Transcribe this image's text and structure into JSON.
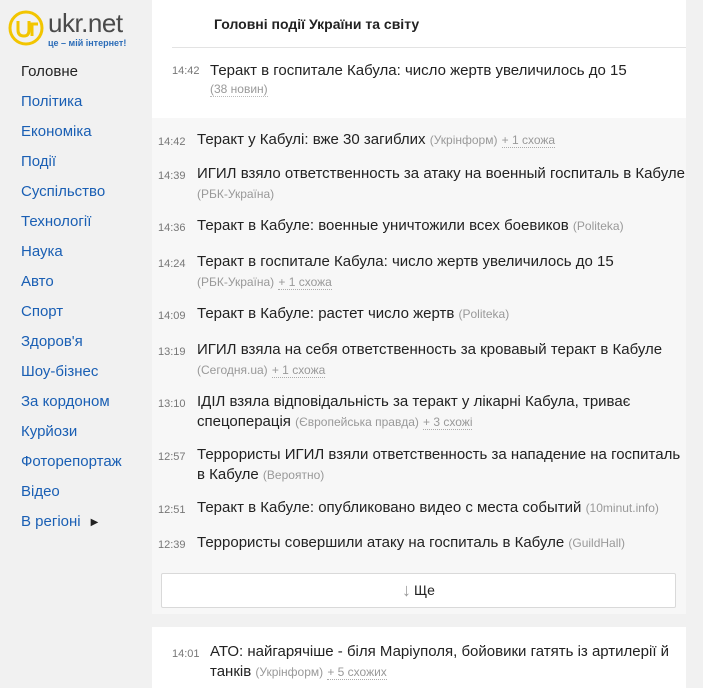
{
  "logo": {
    "name": "ukr.net",
    "tagline": "це – мій інтернет!"
  },
  "sidebar": {
    "items": [
      {
        "label": "Головне",
        "active": true
      },
      {
        "label": "Політика"
      },
      {
        "label": "Економіка"
      },
      {
        "label": "Події"
      },
      {
        "label": "Суспільство"
      },
      {
        "label": "Технології"
      },
      {
        "label": "Наука"
      },
      {
        "label": "Авто"
      },
      {
        "label": "Спорт"
      },
      {
        "label": "Здоров'я"
      },
      {
        "label": "Шоу-бізнес"
      },
      {
        "label": "За кордоном"
      },
      {
        "label": "Курйози"
      },
      {
        "label": "Фоторепортаж"
      },
      {
        "label": "Відео"
      },
      {
        "label": "В регіоні"
      }
    ]
  },
  "header": {
    "title": "Головні події України та світу"
  },
  "lead": {
    "time": "14:42",
    "title": "Теракт в госпитале Кабула: число жертв увеличилось до 15",
    "count": "(38 новин)"
  },
  "news": [
    {
      "time": "14:42",
      "title": "Теракт у Кабулі: вже 30 загиблих",
      "source": "(Укрінформ)",
      "similar": "+ 1 схожа"
    },
    {
      "time": "14:39",
      "title": "ИГИЛ взяло ответственность за атаку на военный госпиталь в Кабуле",
      "source": "(РБК-Україна)",
      "similar": ""
    },
    {
      "time": "14:36",
      "title": "Теракт в Кабуле: военные уничтожили всех боевиков",
      "source": "(Politeka)",
      "similar": ""
    },
    {
      "time": "14:24",
      "title": "Теракт в госпитале Кабула: число жертв увеличилось до 15",
      "source": "(РБК-Україна)",
      "similar": "+ 1 схожа"
    },
    {
      "time": "14:09",
      "title": "Теракт в Кабуле: растет число жертв",
      "source": "(Politeka)",
      "similar": ""
    },
    {
      "time": "13:19",
      "title": "ИГИЛ взяла на себя ответственность за кровавый теракт в Кабуле",
      "source": "(Сегодня.ua)",
      "similar": "+ 1 схожа"
    },
    {
      "time": "13:10",
      "title": "ІДІЛ взяла відповідальність за теракт у лікарні Кабула, триває спецоперація",
      "source": "(Європейська правда)",
      "similar": "+ 3 схожі"
    },
    {
      "time": "12:57",
      "title": "Террористы ИГИЛ взяли ответственность за нападение на госпиталь в Кабуле",
      "source": "(Вероятно)",
      "similar": ""
    },
    {
      "time": "12:51",
      "title": "Теракт в Кабуле: опубликовано видео с места событий",
      "source": "(10minut.info)",
      "similar": ""
    },
    {
      "time": "12:39",
      "title": "Террористы совершили атаку на госпиталь в Кабуле",
      "source": "(GuildHall)",
      "similar": ""
    }
  ],
  "more_button": {
    "label": "Ще",
    "arrow": "↓"
  },
  "next_lead": {
    "time": "14:01",
    "title": "АТО: найгарячіше - біля Маріуполя, бойовики гатять із артилерії й танків",
    "source": "(Укрінформ)",
    "similar": "+ 5 схожих"
  },
  "colors": {
    "link": "#1a5fb4",
    "muted": "#999999",
    "logo_yellow": "#f2c500"
  }
}
